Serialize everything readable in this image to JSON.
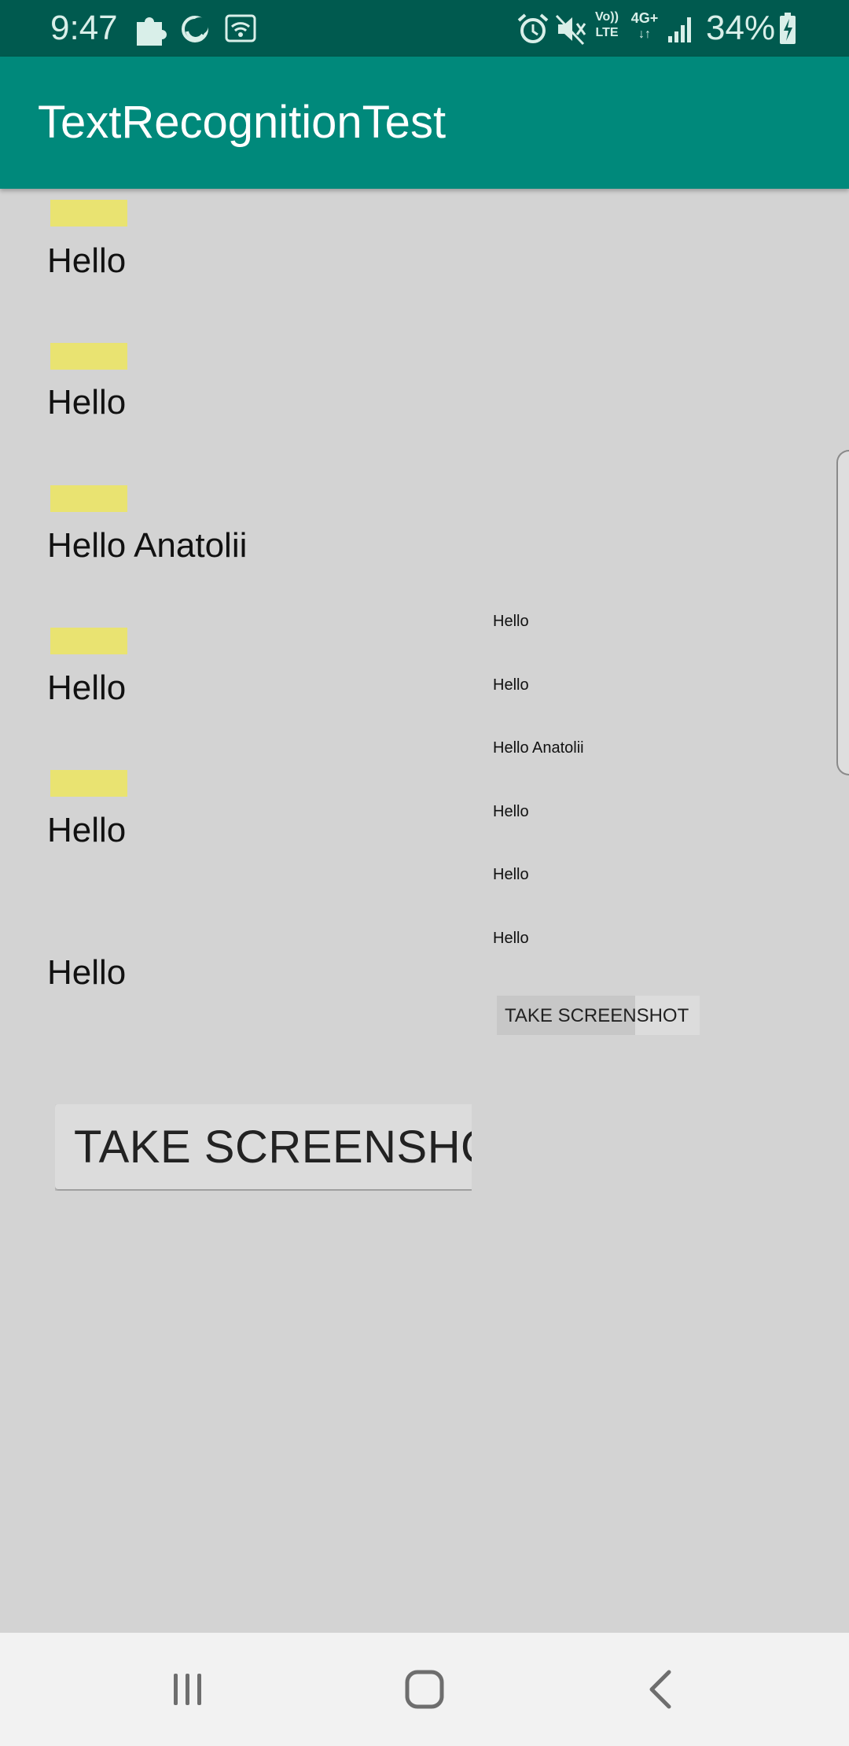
{
  "status_bar": {
    "time": "9:47",
    "battery": "34%",
    "icons": [
      "puzzle-icon",
      "moon-icon",
      "wifi-icon",
      "alarm-icon",
      "mute-icon",
      "volte-icon",
      "4g-icon",
      "signal-icon",
      "battery-charging-icon"
    ],
    "volte_top": "Vo))",
    "volte_bottom": "LTE",
    "network": "4G+"
  },
  "app_bar": {
    "title": "TextRecognitionTest",
    "color": "#00897b"
  },
  "left_items": [
    {
      "text": "Hello",
      "highlight": true
    },
    {
      "text": "Hello",
      "highlight": true
    },
    {
      "text": "Hello Anatolii",
      "highlight": true
    },
    {
      "text": "Hello",
      "highlight": true
    },
    {
      "text": "Hello",
      "highlight": true
    },
    {
      "text": "Hello",
      "highlight": false
    }
  ],
  "right_items": [
    "Hello",
    "Hello",
    "Hello Anatolii",
    "Hello",
    "Hello",
    "Hello"
  ],
  "big_button_label": "TAKE SCREENSHOT",
  "small_button_label": "TAKE SCREENSHOT",
  "colors": {
    "background": "#d3d3d3",
    "highlight": "#e9e371",
    "status_bar": "#005a4f"
  },
  "nav_bar": {
    "buttons": [
      "recents-icon",
      "home-icon",
      "back-icon"
    ]
  }
}
